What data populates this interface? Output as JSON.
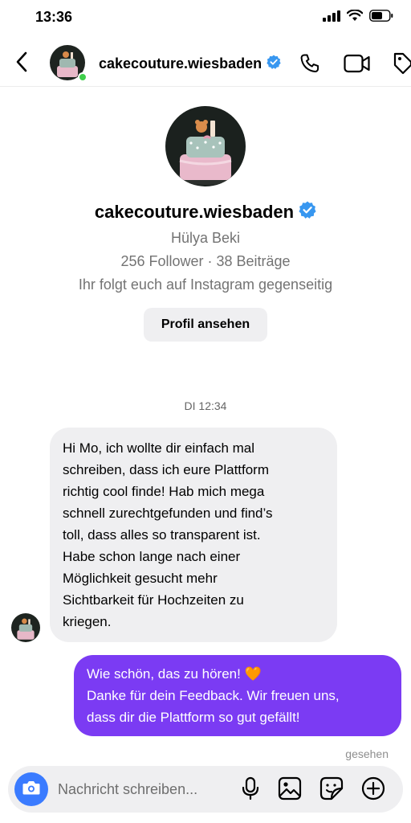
{
  "status_bar": {
    "time": "13:36"
  },
  "header": {
    "username": "cakecouture.wiesbaden",
    "online": true
  },
  "profile": {
    "username": "cakecouture.wiesbaden",
    "full_name": "Hülya Beki",
    "stats": "256 Follower · 38 Beiträge",
    "mutual": "Ihr folgt euch auf Instagram gegenseitig",
    "view_profile_label": "Profil ansehen"
  },
  "conversation": {
    "timestamp": "DI 12:34",
    "incoming": {
      "lines": [
        "Hi Mo, ich wollte dir einfach mal",
        "schreiben, dass ich eure Plattform",
        "richtig cool finde! Hab mich mega",
        "schnell zurechtgefunden und find’s",
        "toll, dass alles so transparent ist.",
        "Habe schon lange nach einer",
        "Möglichkeit gesucht mehr",
        "Sichtbarkeit für Hochzeiten zu",
        "kriegen."
      ]
    },
    "outgoing": {
      "lines": [
        "Wie schön, das zu hören! 🧡",
        "Danke für dein Feedback. Wir freuen uns,",
        "dass dir die Plattform so gut gefällt!"
      ]
    },
    "seen_label": "gesehen"
  },
  "composer": {
    "placeholder": "Nachricht schreiben..."
  },
  "colors": {
    "outgoing_bubble": "#7b3bf3",
    "incoming_bubble": "#efeff1",
    "verified": "#3897f0",
    "camera_button": "#3a7bff",
    "online": "#3fcf4b"
  },
  "icons": {
    "back": "chevron-left-icon",
    "call": "phone-icon",
    "video": "video-camera-icon",
    "tag": "tag-icon",
    "camera": "camera-icon",
    "mic": "microphone-icon",
    "gallery": "image-icon",
    "sticker": "sticker-icon",
    "add": "plus-circle-icon"
  }
}
